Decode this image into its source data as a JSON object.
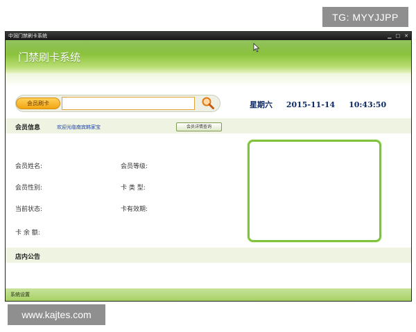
{
  "watermarks": {
    "top": "TG: MYYJJPP",
    "bottom": "www.kajtes.com"
  },
  "window": {
    "title_bar": "中润门禁刷卡系统",
    "banner_title": "门禁刷卡系统"
  },
  "swipe": {
    "label": "会员刷卡",
    "input_value": "",
    "search_icon": "magnifier-icon"
  },
  "datetime": {
    "weekday": "星期六",
    "date": "2015-11-14",
    "time": "10:43:50"
  },
  "member_info": {
    "title": "会员信息",
    "welcome": "欢迎光临南宾韩家宝",
    "detail_button": "会员详情查询",
    "fields": {
      "name": "会员姓名:",
      "level": "会员等级:",
      "gender": "会员性别:",
      "card_type": "卡 类 型:",
      "status": "当前状态:",
      "validity": "卡有效期:",
      "balance": "卡 余 额:"
    }
  },
  "notice": {
    "title": "店内公告"
  },
  "status_bar": {
    "settings": "系统设置"
  },
  "colors": {
    "banner_green": "#8dc43f",
    "accent_orange": "#f2a512",
    "date_blue": "#0c2a66",
    "frame_green": "#7fc33c"
  }
}
